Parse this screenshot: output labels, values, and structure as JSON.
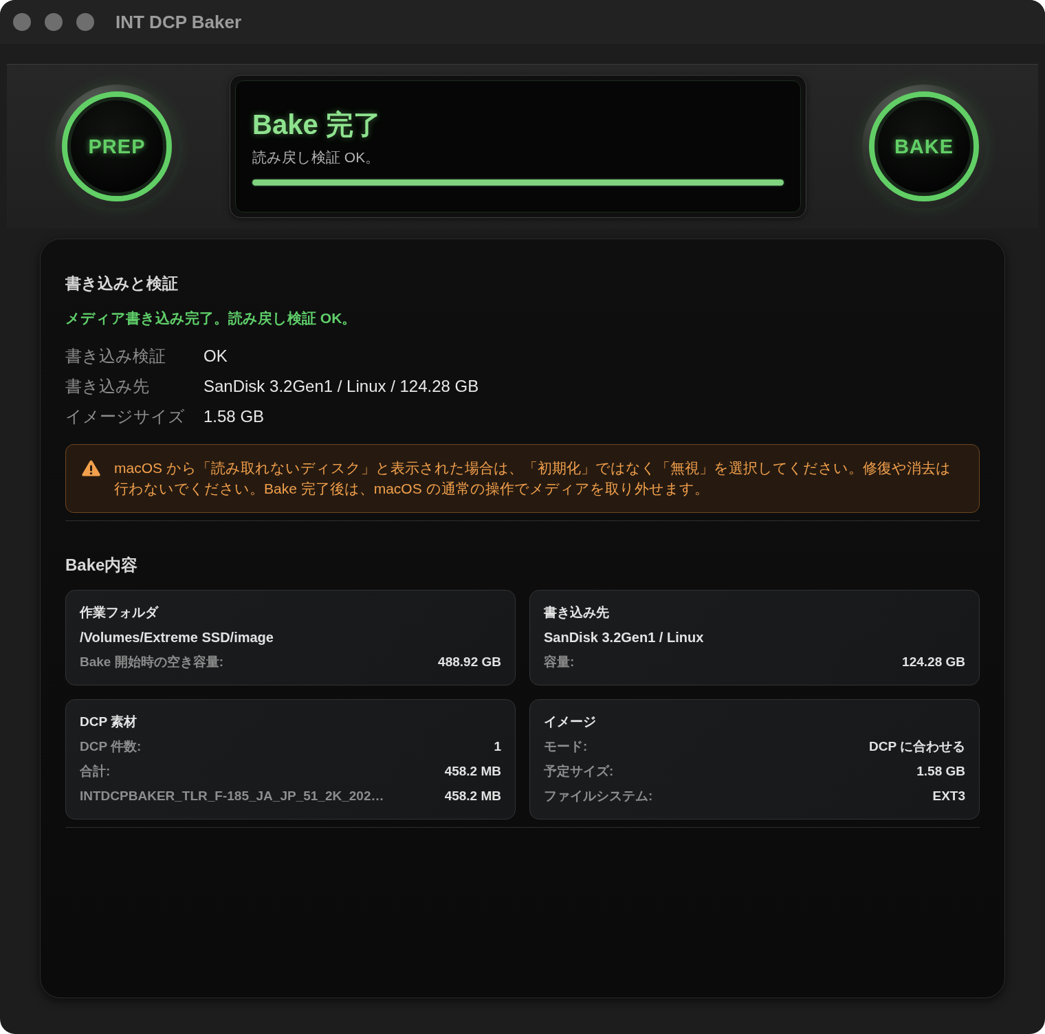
{
  "window": {
    "title": "INT DCP Baker"
  },
  "header": {
    "prep_button": {
      "label": "PREP"
    },
    "status": {
      "title": "Bake 完了",
      "subtitle": "読み戻し検証 OK。",
      "progress": {
        "level": 1
      }
    },
    "bake_button": {
      "label": "BAKE"
    }
  },
  "write_verify": {
    "heading": "書き込みと検証",
    "message": "メディア書き込み完了。読み戻し検証 OK。",
    "fields": [
      {
        "label": "書き込み検証",
        "value": "OK"
      },
      {
        "label": "書き込み先",
        "value": "SanDisk 3.2Gen1 / Linux / 124.28 GB"
      },
      {
        "label": "イメージサイズ",
        "value": "1.58 GB"
      }
    ],
    "warning": {
      "text": "macOS から「読み取れないディスク」と表示された場合は、「初期化」ではなく「無視」を選択してください。修復や消去は行わないでください。Bake 完了後は、macOS の通常の操作でメディアを取り外せます。"
    }
  },
  "bake_contents": {
    "heading": "Bake内容",
    "cards": [
      {
        "title": "作業フォルダ",
        "rows": [
          {
            "kind": "text",
            "text": "/Volumes/Extreme SSD/image"
          },
          {
            "kind": "pair",
            "label": "Bake 開始時の空き容量:",
            "value": "488.92 GB"
          }
        ]
      },
      {
        "title": "書き込み先",
        "rows": [
          {
            "kind": "text",
            "text": "SanDisk 3.2Gen1 / Linux"
          },
          {
            "kind": "pair",
            "label": "容量:",
            "value": "124.28 GB"
          }
        ]
      },
      {
        "title": "DCP 素材",
        "rows": [
          {
            "kind": "pair",
            "label": "DCP 件数:",
            "value": "1"
          },
          {
            "kind": "pair",
            "label": "合計:",
            "value": "458.2 MB"
          },
          {
            "kind": "pair",
            "label": "INTDCPBAKER_TLR_F-185_JA_JP_51_2K_202…",
            "value": "458.2 MB"
          }
        ]
      },
      {
        "title": "イメージ",
        "rows": [
          {
            "kind": "pair",
            "label": "モード:",
            "value": "DCP に合わせる"
          },
          {
            "kind": "pair",
            "label": "予定サイズ:",
            "value": "1.58 GB"
          },
          {
            "kind": "pair",
            "label": "ファイルシステム:",
            "value": "EXT3"
          }
        ]
      }
    ]
  }
}
